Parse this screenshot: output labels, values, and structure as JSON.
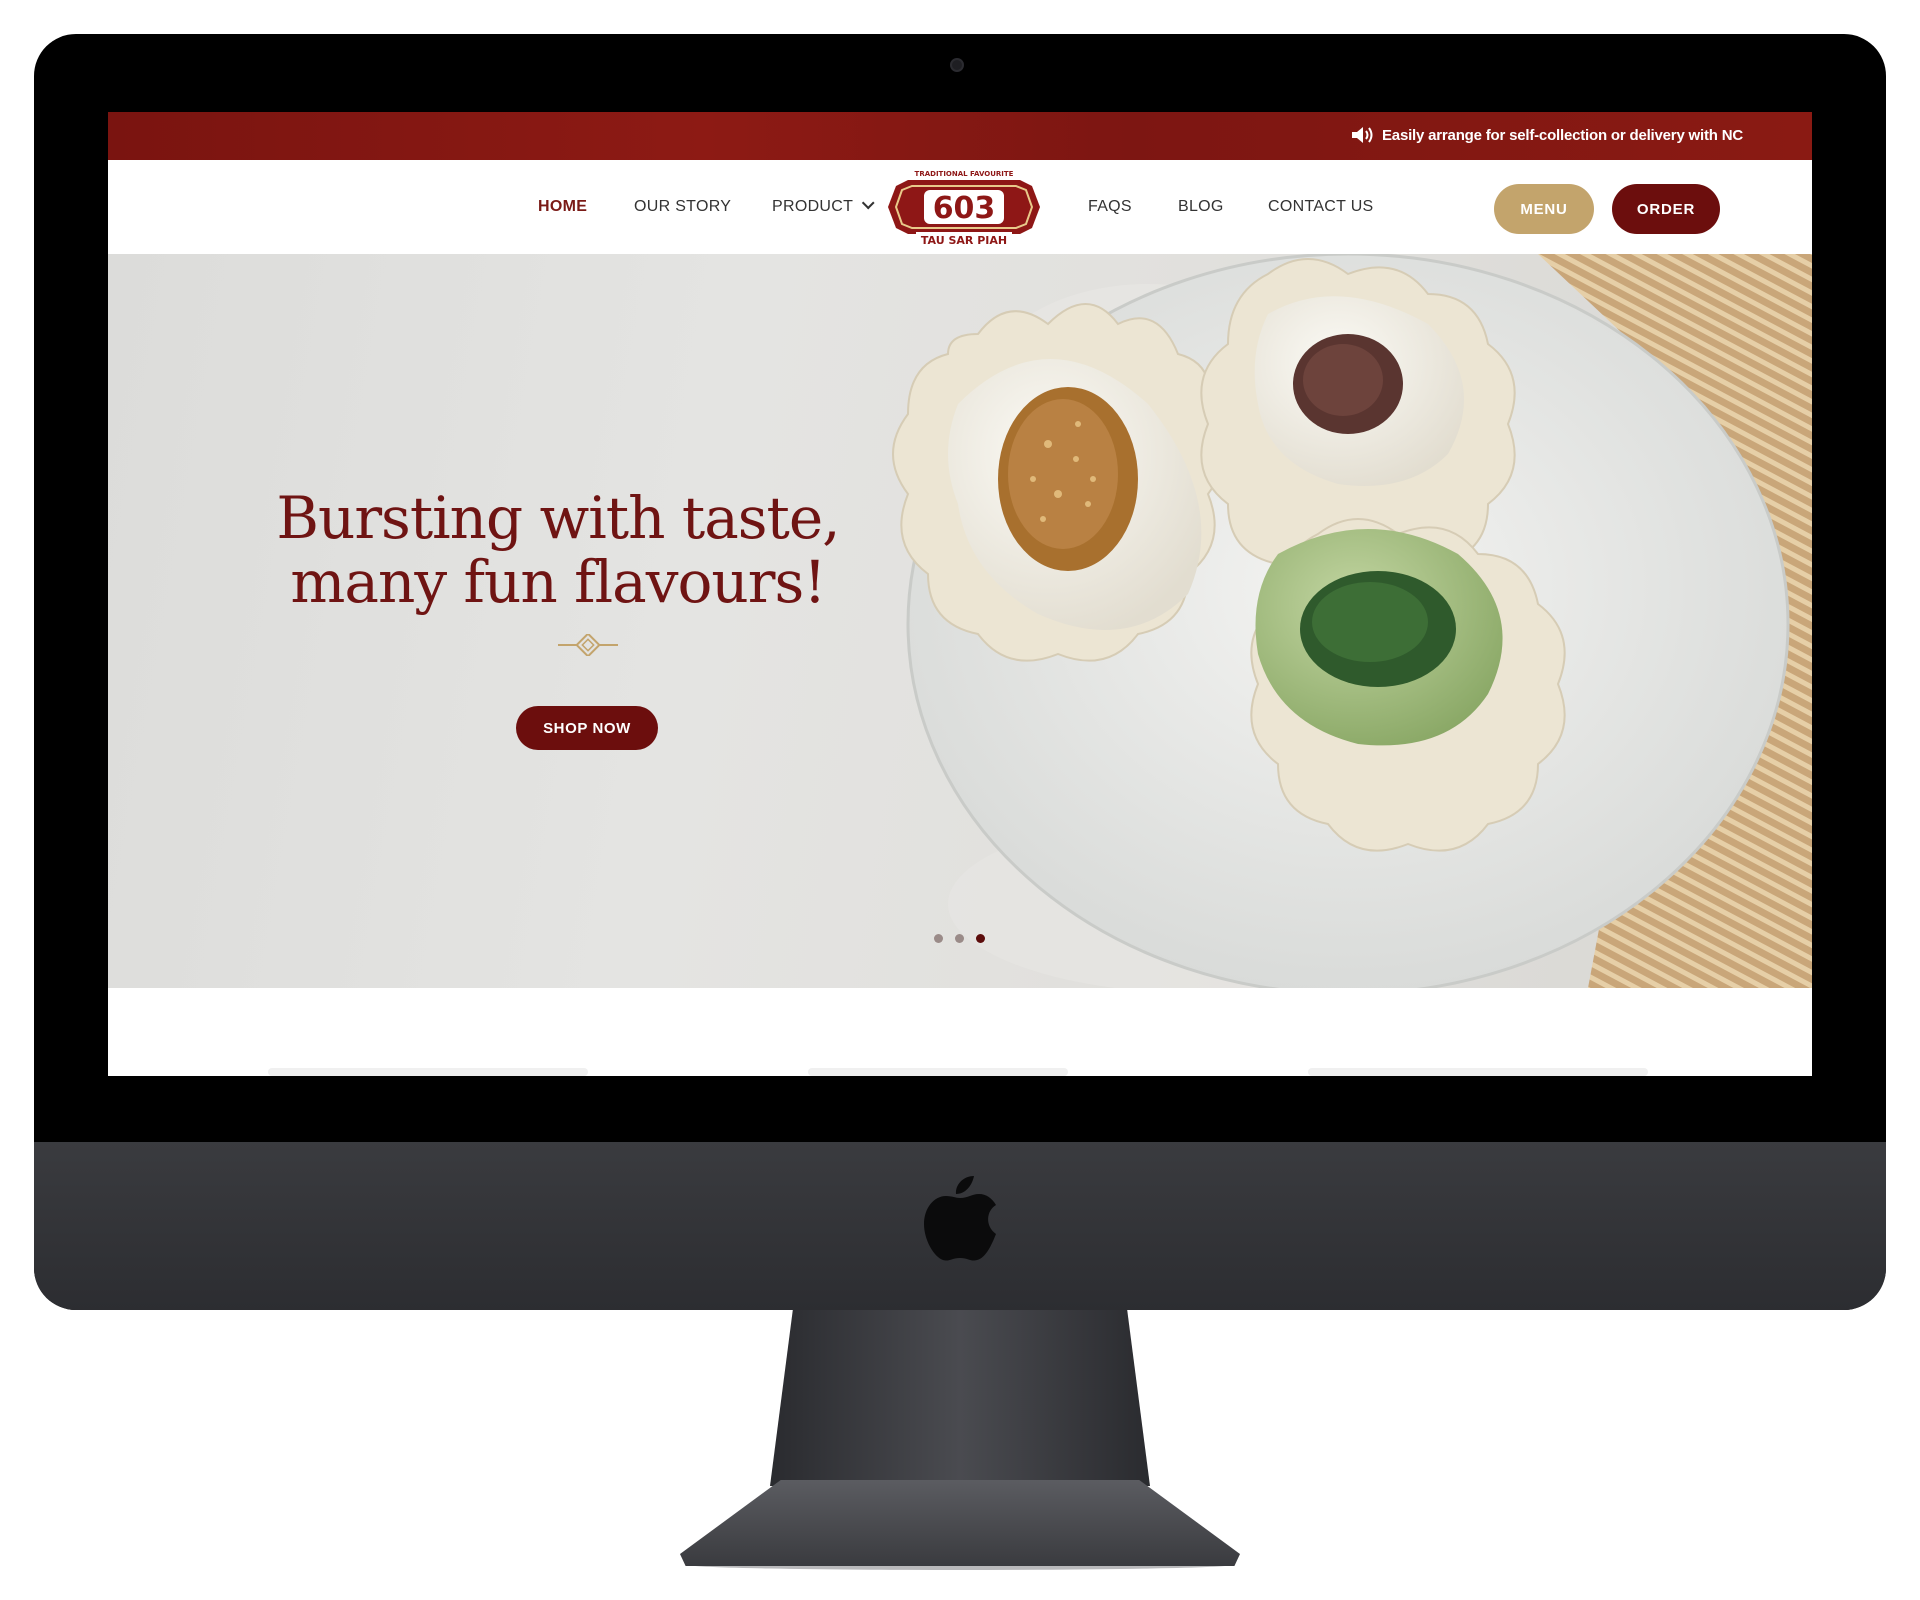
{
  "announcement": {
    "text": "Easily arrange for self-collection or delivery with NC"
  },
  "nav": {
    "items": [
      {
        "label": "HOME"
      },
      {
        "label": "OUR STORY"
      },
      {
        "label": "PRODUCT"
      },
      {
        "label": "FAQS"
      },
      {
        "label": "BLOG"
      },
      {
        "label": "CONTACT US"
      }
    ],
    "active": "HOME",
    "menu_button": "MENU",
    "order_button": "ORDER"
  },
  "logo": {
    "top_text": "TRADITIONAL FAVOURITE",
    "number": "603",
    "bottom_text": "TAU SAR PIAH"
  },
  "hero": {
    "title_line1": "Bursting with taste,",
    "title_line2": "many fun flavours!",
    "cta": "SHOP NOW",
    "slides": 3,
    "active_slide": 3
  },
  "colors": {
    "brand_red": "#6c0e0d",
    "announcement_bg": "#8d1a14",
    "menu_gold": "#c3a46c",
    "title_red": "#6f1413"
  }
}
